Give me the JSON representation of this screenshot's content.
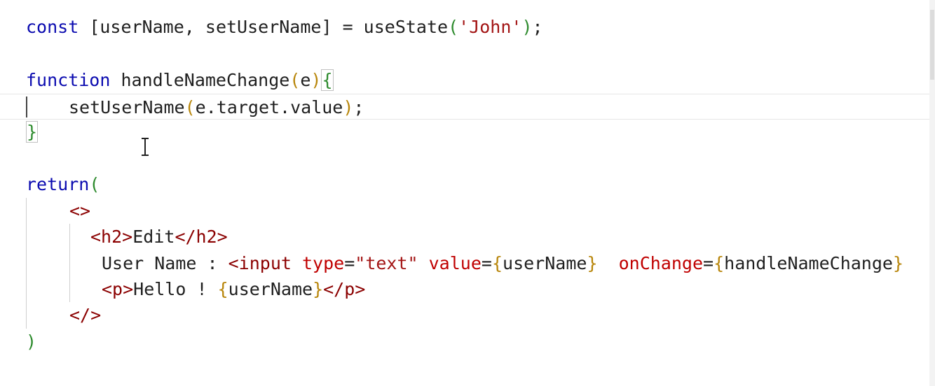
{
  "code": {
    "line1": {
      "k_const": "const",
      "p_open": " [",
      "v_names": "userName, setUserName",
      "p_close": "]",
      "eq": " = ",
      "fn": "useState",
      "po": "(",
      "s": "'John'",
      "pc": ")",
      "semi": ";"
    },
    "line2": {
      "k_function": "function",
      "name": " handleNameChange",
      "po": "(",
      "param": "e",
      "pc": ")",
      "brace": "{"
    },
    "line3": {
      "call": "setUserName",
      "po": "(",
      "arg": "e.target.value",
      "pc": ")",
      "semi": ";"
    },
    "line4": {
      "brace": "}"
    },
    "line5": {
      "k_return": "return",
      "po": "("
    },
    "line6": {
      "frag_open": "<>"
    },
    "line7": {
      "t_open": "<h2>",
      "text": "Edit",
      "t_close": "</h2>"
    },
    "line8": {
      "label": "User Name : ",
      "t_input": "<input",
      "a_type": " type",
      "eq1": "=",
      "s_text": "\"text\"",
      "a_value": " value",
      "eq2": "=",
      "b1o": "{",
      "v1": "userName",
      "b1c": "}",
      "a_onchange": "  onChange",
      "eq3": "=",
      "b2o": "{",
      "v2": "handleNameChange",
      "b2c": "}"
    },
    "line9": {
      "t_open": "<p>",
      "text": "Hello ! ",
      "bo": "{",
      "v": "userName",
      "bc": "}",
      "t_close": "</p>"
    },
    "line10": {
      "frag_close": "</>"
    },
    "line11": {
      "pc": ")"
    }
  }
}
